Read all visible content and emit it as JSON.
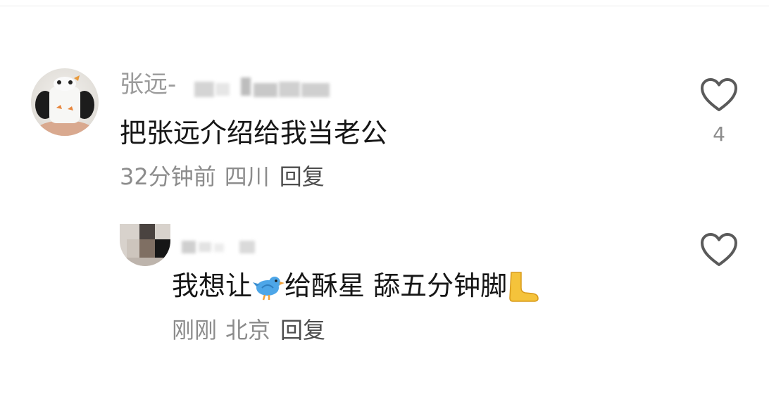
{
  "comments": [
    {
      "author": "张远-",
      "text": "把张远介绍给我当老公",
      "time": "32分钟前",
      "location": "四川",
      "reply_label": "回复",
      "like_count": "4",
      "like_icon": "heart-outline-icon"
    }
  ],
  "replies": [
    {
      "text_part1": "我想让",
      "emoji1": "bird-emoji",
      "text_part2": "给酥星 舔五分钟脚",
      "emoji2": "foot-emoji",
      "time": "刚刚",
      "location": "北京",
      "reply_label": "回复",
      "like_icon": "heart-outline-icon"
    }
  ],
  "colors": {
    "name": "#9b9b9b",
    "meta": "#8c8c8c",
    "reply": "#4d4d4d",
    "text": "#161616",
    "heart": "#5a5a5a"
  }
}
